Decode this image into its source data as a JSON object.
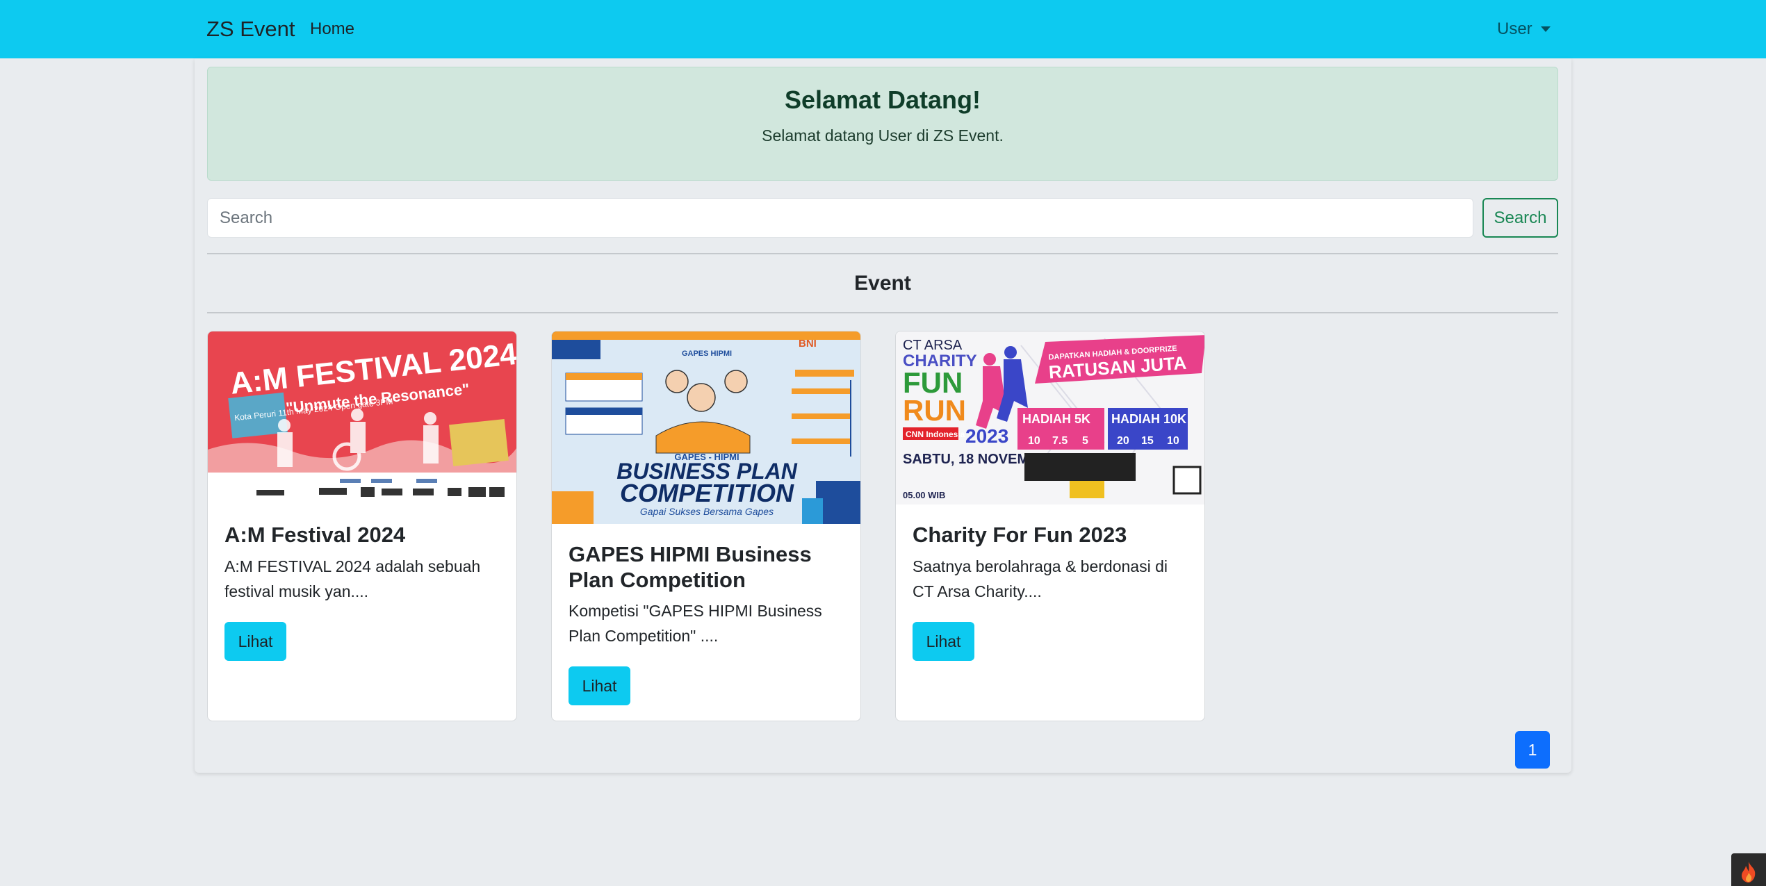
{
  "navbar": {
    "brand": "ZS Event",
    "home": "Home",
    "user": "User"
  },
  "alert": {
    "title": "Selamat Datang!",
    "message": "Selamat datang User di ZS Event."
  },
  "search": {
    "placeholder": "Search",
    "button": "Search"
  },
  "section_title": "Event",
  "events": [
    {
      "title": "A:M Festival 2024",
      "desc": "A:M FESTIVAL 2024 adalah sebuah festival musik yan....",
      "button": "Lihat",
      "poster": {
        "headline": "A:M FESTIVAL 2024",
        "tagline": "\"Unmute the Resonance\"",
        "info": "Kota Peruri 11th May 2024 Open gate 3PM"
      }
    },
    {
      "title": "GAPES HIPMI Business Plan Competition",
      "desc": "Kompetisi \"GAPES HIPMI Business Plan Competition\" ....",
      "button": "Lihat",
      "poster": {
        "kicker": "GAPES - HIPMI",
        "headline1": "BUSINESS PLAN",
        "headline2": "COMPETITION",
        "tagline": "Gapai Sukses Bersama Gapes",
        "bank": "BNI"
      }
    },
    {
      "title": "Charity For Fun 2023",
      "desc": "Saatnya berolahraga & berdonasi di CT Arsa Charity....",
      "button": "Lihat",
      "poster": {
        "org": "CT ARSA",
        "line1": "CHARITY",
        "line2": "FUN",
        "line3": "RUN",
        "year": "2023",
        "banner": "RATUSAN JUTA",
        "prize5k": "HADIAH 5K",
        "prize10k": "HADIAH 10K",
        "date": "SABTU, 18 NOVEMBER 2023"
      }
    }
  ],
  "pagination": {
    "current": "1"
  },
  "colors": {
    "navbar": "#0dcaf0",
    "alert_bg": "#d1e7dd",
    "success": "#198754",
    "primary": "#0d6efd"
  }
}
